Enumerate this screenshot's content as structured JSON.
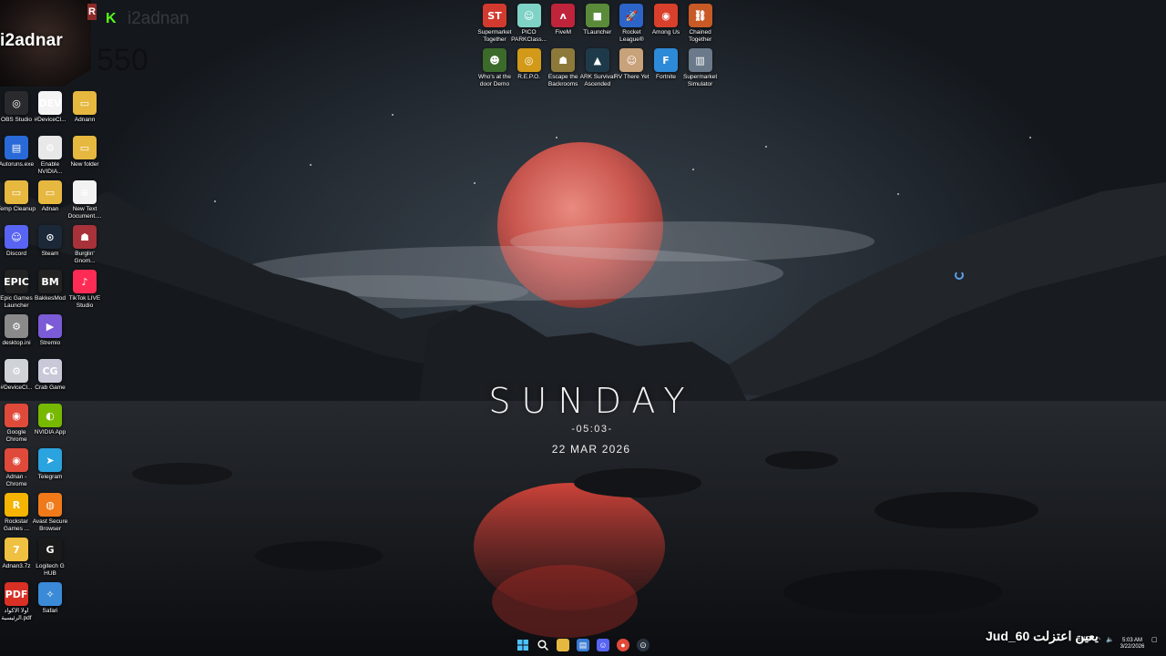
{
  "overlay": {
    "streamer_name": "i2adnar",
    "channel_user": "i2adnan",
    "counter": "550",
    "kick_icon": "kick-logo-icon",
    "r_badge": "R"
  },
  "clock_widget": {
    "day": "SUNDAY",
    "time": "-05:03-",
    "date": "22 MAR 2026"
  },
  "desktop": {
    "top_games": [
      {
        "label": "Supermarket Together",
        "glyph": "ST",
        "color": "#d33a2f"
      },
      {
        "label": "PICO PARKClass...",
        "glyph": "☺",
        "color": "#7fd3c6"
      },
      {
        "label": "FiveM",
        "glyph": "ʌ",
        "color": "#c0243a"
      },
      {
        "label": "TLauncher",
        "glyph": "■",
        "color": "#5a8a3a"
      },
      {
        "label": "Rocket League®",
        "glyph": "🚀",
        "color": "#2d64c8"
      },
      {
        "label": "Among Us",
        "glyph": "◉",
        "color": "#d8402c"
      },
      {
        "label": "Chained Together",
        "glyph": "⛓",
        "color": "#c85a26"
      },
      {
        "label": "Who's at the door Demo",
        "glyph": "☻",
        "color": "#3c6a2a"
      },
      {
        "label": "R.E.P.O.",
        "glyph": "◎",
        "color": "#d29a18"
      },
      {
        "label": "Escape the Backrooms",
        "glyph": "☗",
        "color": "#8d7a3a"
      },
      {
        "label": "ARK Survival Ascended",
        "glyph": "▲",
        "color": "#1e3a4a"
      },
      {
        "label": "RV There Yet",
        "glyph": "☺",
        "color": "#c8a27a"
      },
      {
        "label": "Fortnite",
        "glyph": "F",
        "color": "#2d8ad8"
      },
      {
        "label": "Supermarket Simulator",
        "glyph": "▥",
        "color": "#6a7a8a"
      }
    ],
    "col1": [
      {
        "label": "OBS Studio",
        "glyph": "◎",
        "color": "#2a2a2e"
      },
      {
        "label": "Autoruns.exe",
        "glyph": "▤",
        "color": "#2a6ad8"
      },
      {
        "label": "Temp Cleanup",
        "glyph": "▭",
        "color": "#e6b840"
      },
      {
        "label": "Discord",
        "glyph": "☺",
        "color": "#5865f2"
      },
      {
        "label": "Epic Games Launcher",
        "glyph": "EPIC",
        "color": "#222222"
      },
      {
        "label": "desktop.ini",
        "glyph": "⚙",
        "color": "#8a8a8a"
      },
      {
        "label": "#DeviceCl...",
        "glyph": "⚙",
        "color": "#cfd3d8"
      },
      {
        "label": "Google Chrome",
        "glyph": "◉",
        "color": "#e04a3a"
      },
      {
        "label": "Adnan - Chrome",
        "glyph": "◉",
        "color": "#e04a3a"
      },
      {
        "label": "Rockstar Games ...",
        "glyph": "R",
        "color": "#f4b400"
      },
      {
        "label": "Adnan3.7z",
        "glyph": "7",
        "color": "#f0c040"
      },
      {
        "label": "أولا الأكواد الرئيسية.pdf",
        "glyph": "PDF",
        "color": "#d93025"
      }
    ],
    "col2": [
      {
        "label": "#DeviceCl...",
        "glyph": "DEV",
        "color": "#f4f4f4"
      },
      {
        "label": "Enable NVIDIA...",
        "glyph": "⚙",
        "color": "#e8e8e8"
      },
      {
        "label": "Adnan",
        "glyph": "▭",
        "color": "#e6b840"
      },
      {
        "label": "Steam",
        "glyph": "⊙",
        "color": "#1b2838"
      },
      {
        "label": "BakkesMod",
        "glyph": "BM",
        "color": "#222222"
      },
      {
        "label": "Stremio",
        "glyph": "▶",
        "color": "#7b5bd6"
      },
      {
        "label": "Crab Game",
        "glyph": "CG",
        "color": "#c8c8d8"
      },
      {
        "label": "NVIDIA App",
        "glyph": "◐",
        "color": "#76b900"
      },
      {
        "label": "Telegram",
        "glyph": "➤",
        "color": "#2aa3df"
      },
      {
        "label": "Avast Secure Browser",
        "glyph": "◍",
        "color": "#f07a1a"
      },
      {
        "label": "Logitech G HUB",
        "glyph": "G",
        "color": "#1a1a1a"
      },
      {
        "label": "Safari",
        "glyph": "✧",
        "color": "#3a8ad8"
      }
    ],
    "col3": [
      {
        "label": "Adnann",
        "glyph": "▭",
        "color": "#e6b840"
      },
      {
        "label": "New folder",
        "glyph": "▭",
        "color": "#e6b840"
      },
      {
        "label": "New Text Document....",
        "glyph": "≡",
        "color": "#f2f2f2"
      },
      {
        "label": "Burglin' Gnom...",
        "glyph": "☗",
        "color": "#a8323a"
      },
      {
        "label": "TikTok LIVE Studio",
        "glyph": "♪",
        "color": "#fe2c55"
      }
    ]
  },
  "taskbar": {
    "items": [
      "windows-start-icon",
      "search-icon",
      "file-explorer-icon",
      "store-icon",
      "discord-icon",
      "chrome-icon",
      "steam-icon"
    ],
    "overlay_text": "Jud_60  يعين اعتزلت",
    "language": "ENG",
    "clock_time": "5:03 AM",
    "clock_date": "3/22/2026"
  }
}
